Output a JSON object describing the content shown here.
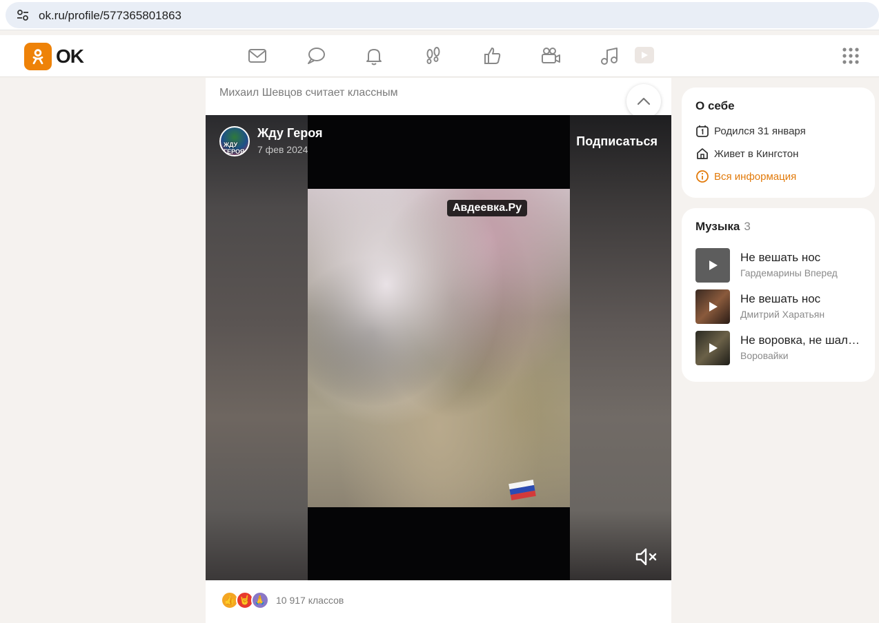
{
  "browser": {
    "url": "ok.ru/profile/577365801863",
    "site_settings_icon": "tune-icon"
  },
  "header": {
    "logo_text": "OK",
    "brand_color": "#ee8208",
    "nav_icons": [
      "messages-icon",
      "discussions-icon",
      "notifications-icon",
      "guests-icon",
      "marks-icon",
      "video-icon",
      "music-icon",
      "videos-play-icon"
    ],
    "apps_icon": "grid-menu-icon"
  },
  "feed": {
    "liked_by": "Михаил Шевцов считает классным",
    "post": {
      "author": "Жду Героя",
      "avatar_text": "ЖДУ ГЕРОЯ",
      "date": "7 фев 2024",
      "subscribe_label": "Подписаться",
      "watermark": "Авдеевка.Ру",
      "mute_icon": "volume-mute-icon"
    },
    "reactions": {
      "icons": [
        "like-reaction",
        "rock-reaction",
        "pray-reaction"
      ],
      "count": "10 917 классов"
    }
  },
  "sidebar": {
    "about": {
      "title": "О себе",
      "birthday": "Родился 31 января",
      "location": "Живет в Кингстон",
      "all_info": "Вся информация"
    },
    "music": {
      "title": "Музыка",
      "count": "3",
      "tracks": [
        {
          "title": "Не вешать нос",
          "artist": "Гардемарины Вперед"
        },
        {
          "title": "Не вешать нос",
          "artist": "Дмитрий Харатьян"
        },
        {
          "title": "Не воровка, не шалава",
          "artist": "Воровайки"
        }
      ]
    }
  }
}
